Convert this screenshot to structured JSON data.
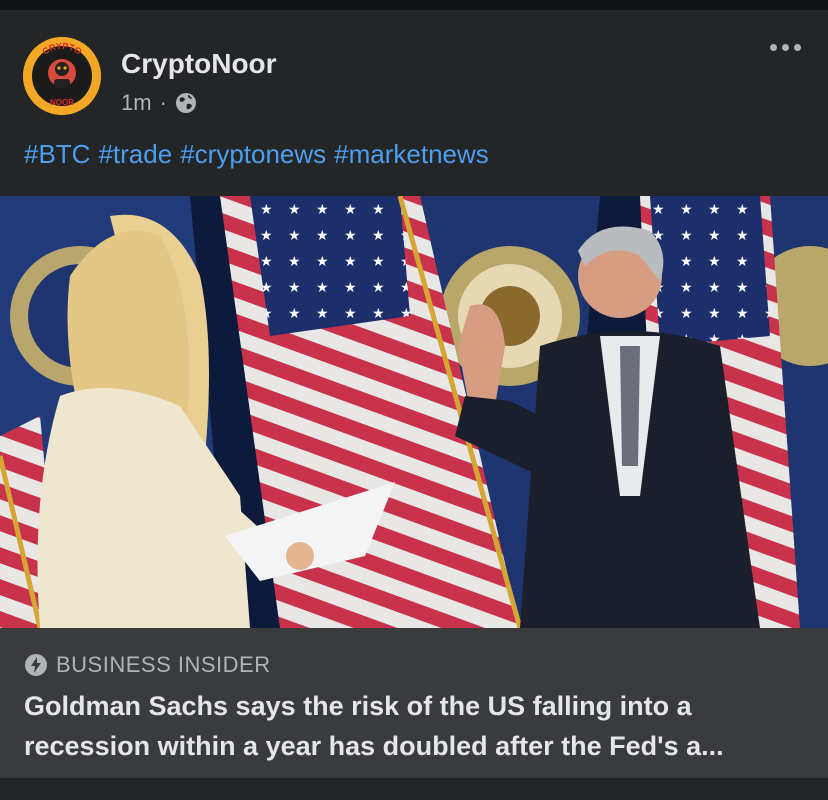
{
  "post": {
    "author": "CryptoNoor",
    "time": "1m",
    "separator": "·",
    "visibility_icon": "globe-icon",
    "more_icon": "more-options-icon",
    "hashtags": [
      "#BTC",
      "#trade",
      "#cryptonews",
      "#marketnews"
    ],
    "avatar_text_top": "CRYPTO",
    "avatar_text_bottom": "NOOR"
  },
  "link_preview": {
    "source": "BUSINESS INSIDER",
    "source_icon": "lightning-bolt-icon",
    "headline": "Goldman Sachs says the risk of the US falling into a recession within a year has doubled after the Fed's a..."
  },
  "colors": {
    "background": "#18191a",
    "card": "#242526",
    "link_box": "#3a3b3c",
    "hashtag": "#4b9ef0",
    "text_primary": "#e4e6eb",
    "text_secondary": "#b0b3b8",
    "avatar_bg": "#f3a825"
  }
}
